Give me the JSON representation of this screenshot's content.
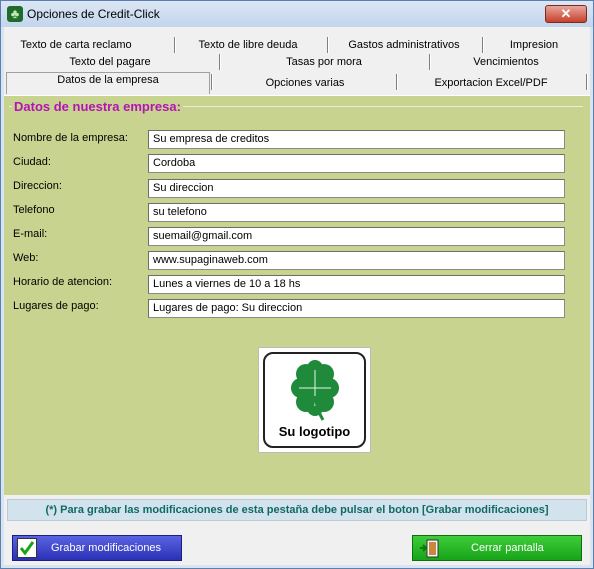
{
  "window": {
    "title": "Opciones de Credit-Click",
    "close_glyph": "✕",
    "app_icon": "four-leaf-clover-icon"
  },
  "tabs": {
    "row1": [
      "Texto de carta reclamo",
      "Texto de libre deuda",
      "Gastos administrativos",
      "Impresion"
    ],
    "row2": [
      "Texto del pagare",
      "Tasas por mora",
      "Vencimientos"
    ],
    "row3": [
      "Datos de la empresa",
      "Opciones varias",
      "Exportacion Excel/PDF"
    ],
    "active": "Datos de la empresa"
  },
  "group": {
    "title": "Datos de nuestra empresa:"
  },
  "fields": [
    {
      "label": "Nombre de la empresa:",
      "value": "Su empresa de creditos"
    },
    {
      "label": "Ciudad:",
      "value": "Cordoba"
    },
    {
      "label": "Direccion:",
      "value": "Su direccion"
    },
    {
      "label": "Telefono",
      "value": "su telefono"
    },
    {
      "label": "E-mail:",
      "value": "suemail@gmail.com"
    },
    {
      "label": "Web:",
      "value": "www.supaginaweb.com"
    },
    {
      "label": "Horario de atencion:",
      "value": "Lunes a viernes de 10 a 18 hs"
    },
    {
      "label": "Lugares de pago:",
      "value": "Lugares de pago: Su direccion"
    }
  ],
  "logo": {
    "text": "Su logotipo",
    "icon": "four-leaf-clover-icon"
  },
  "note": "(*) Para grabar las modificaciones de esta pestaña debe pulsar el boton [Grabar modificaciones]",
  "buttons": {
    "save": "Grabar modificaciones",
    "close": "Cerrar pantalla"
  },
  "colors": {
    "panel": "#c8d38f",
    "group_title": "#b514b5",
    "note_text": "#0f6a64",
    "save_button": "#3a41cf",
    "close_button": "#22b624"
  }
}
